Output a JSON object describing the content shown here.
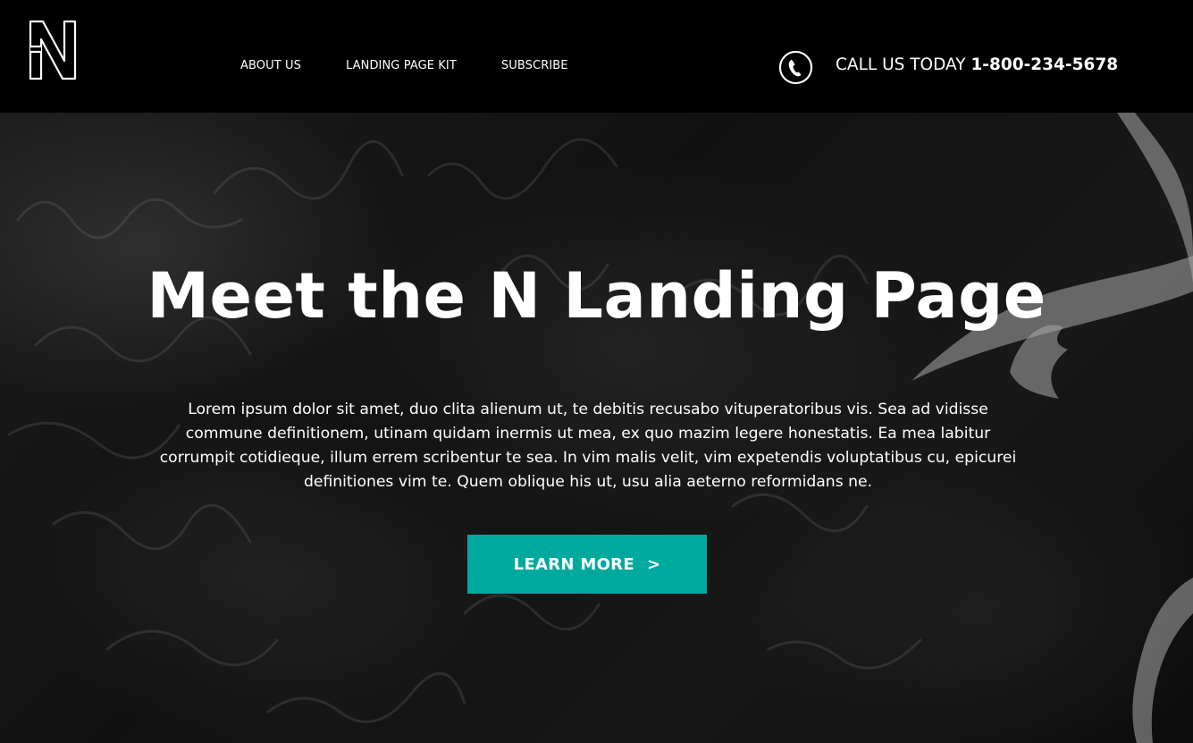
{
  "header": {
    "logo_icon": "n-logo-icon",
    "nav": [
      {
        "label": "ABOUT US"
      },
      {
        "label": "LANDING PAGE KIT"
      },
      {
        "label": "SUBSCRIBE"
      }
    ],
    "phone_icon": "phone-icon",
    "call_label": "CALL US TODAY",
    "phone_number": "1-800-234-5678"
  },
  "hero": {
    "title": "Meet the N Landing Page",
    "description": "Lorem ipsum dolor sit amet, duo clita alienum ut, te debitis recusabo vituperatoribus vis. Sea ad vidisse commune definitionem, utinam quidam inermis ut mea, ex quo mazim legere honestatis. Ea mea labitur corrumpit cotidieque, illum errem scribentur te sea. In vim malis velit, vim expetendis voluptatibus cu, epicurei definitiones vim te. Quem oblique his ut, usu alia aeterno reformidans ne.",
    "cta_label": "LEARN MORE",
    "cta_chevron": ">",
    "cta_color": "#00a99d"
  }
}
